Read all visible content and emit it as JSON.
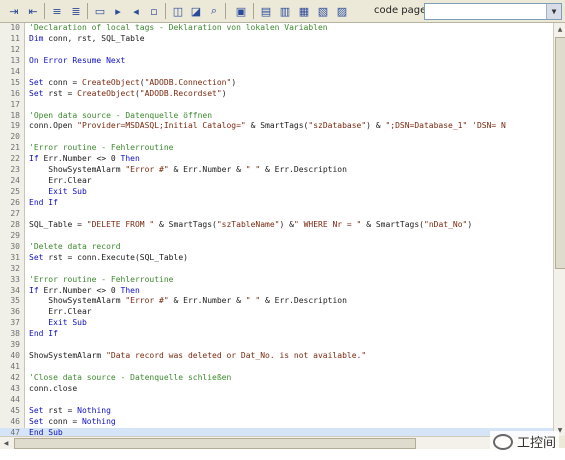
{
  "toolbar": {
    "code_page_label": "code page",
    "code_page_value": "",
    "icons": [
      "indent-icon",
      "outdent-icon",
      "comment-icon",
      "uncomment-icon",
      "toggle-bookmark-icon",
      "bookmark-next-icon",
      "bookmark-prev-icon",
      "clear-bookmarks-icon",
      "tag-icon",
      "insert-tag-icon",
      "find-icon",
      "replace-icon",
      "run-icon",
      "check-syntax-icon",
      "insert-script-icon",
      "tag-list-icon",
      "help-icon"
    ]
  },
  "code": {
    "lines": [
      {
        "n": "10",
        "tokens": [
          {
            "t": "'Declaration of local tags - Deklaration von lokalen Variablen",
            "c": "comment"
          }
        ]
      },
      {
        "n": "11",
        "tokens": [
          {
            "t": "Dim",
            "c": "keyword"
          },
          {
            "t": " conn, rst, SQL_Table",
            "c": "ident"
          }
        ]
      },
      {
        "n": "12",
        "tokens": []
      },
      {
        "n": "13",
        "tokens": [
          {
            "t": "On Error Resume Next",
            "c": "keyword"
          }
        ]
      },
      {
        "n": "14",
        "tokens": []
      },
      {
        "n": "15",
        "tokens": [
          {
            "t": "Set",
            "c": "keyword"
          },
          {
            "t": " conn = ",
            "c": "ident"
          },
          {
            "t": "CreateObject",
            "c": "string"
          },
          {
            "t": "(",
            "c": "ident"
          },
          {
            "t": "\"ADODB.Connection\"",
            "c": "string"
          },
          {
            "t": ")",
            "c": "ident"
          }
        ]
      },
      {
        "n": "16",
        "tokens": [
          {
            "t": "Set",
            "c": "keyword"
          },
          {
            "t": " rst = ",
            "c": "ident"
          },
          {
            "t": "CreateObject",
            "c": "string"
          },
          {
            "t": "(",
            "c": "ident"
          },
          {
            "t": "\"ADODB.Recordset\"",
            "c": "string"
          },
          {
            "t": ")",
            "c": "ident"
          }
        ]
      },
      {
        "n": "17",
        "tokens": []
      },
      {
        "n": "18",
        "tokens": [
          {
            "t": "'Open data source - Datenquelle öffnen",
            "c": "comment"
          }
        ]
      },
      {
        "n": "19",
        "tokens": [
          {
            "t": "conn.Open ",
            "c": "ident"
          },
          {
            "t": "\"Provider=MSDASQL;Initial Catalog=\"",
            "c": "string"
          },
          {
            "t": " & SmartTags(",
            "c": "ident"
          },
          {
            "t": "\"szDatabase\"",
            "c": "string"
          },
          {
            "t": ") & ",
            "c": "ident"
          },
          {
            "t": "\";DSN=Database_1\" 'DSN= N",
            "c": "string"
          }
        ]
      },
      {
        "n": "20",
        "tokens": []
      },
      {
        "n": "21",
        "tokens": [
          {
            "t": "'Error routine - Fehlerroutine",
            "c": "comment"
          }
        ]
      },
      {
        "n": "22",
        "tokens": [
          {
            "t": "If",
            "c": "keyword"
          },
          {
            "t": " Err.Number <> 0 ",
            "c": "ident"
          },
          {
            "t": "Then",
            "c": "keyword"
          }
        ]
      },
      {
        "n": "23",
        "tokens": [
          {
            "t": "    ShowSystemAlarm ",
            "c": "ident"
          },
          {
            "t": "\"Error #\"",
            "c": "string"
          },
          {
            "t": " & Err.Number & ",
            "c": "ident"
          },
          {
            "t": "\" \"",
            "c": "string"
          },
          {
            "t": " & Err.Description",
            "c": "ident"
          }
        ]
      },
      {
        "n": "24",
        "tokens": [
          {
            "t": "    Err.Clear",
            "c": "ident"
          }
        ]
      },
      {
        "n": "25",
        "tokens": [
          {
            "t": "    Exit Sub",
            "c": "keyword"
          }
        ]
      },
      {
        "n": "26",
        "tokens": [
          {
            "t": "End If",
            "c": "keyword"
          }
        ]
      },
      {
        "n": "27",
        "tokens": []
      },
      {
        "n": "28",
        "tokens": [
          {
            "t": "SQL_Table = ",
            "c": "ident"
          },
          {
            "t": "\"DELETE FROM \"",
            "c": "string"
          },
          {
            "t": " & SmartTags(",
            "c": "ident"
          },
          {
            "t": "\"szTableName\"",
            "c": "string"
          },
          {
            "t": ") &",
            "c": "ident"
          },
          {
            "t": "\" WHERE Nr = \"",
            "c": "string"
          },
          {
            "t": " & SmartTags(",
            "c": "ident"
          },
          {
            "t": "\"nDat_No\"",
            "c": "string"
          },
          {
            "t": ")",
            "c": "ident"
          }
        ]
      },
      {
        "n": "29",
        "tokens": []
      },
      {
        "n": "30",
        "tokens": [
          {
            "t": "'Delete data record",
            "c": "comment"
          }
        ]
      },
      {
        "n": "31",
        "tokens": [
          {
            "t": "Set",
            "c": "keyword"
          },
          {
            "t": " rst = conn.Execute(SQL_Table)",
            "c": "ident"
          }
        ]
      },
      {
        "n": "32",
        "tokens": []
      },
      {
        "n": "33",
        "tokens": [
          {
            "t": "'Error routine - Fehlerroutine",
            "c": "comment"
          }
        ]
      },
      {
        "n": "34",
        "tokens": [
          {
            "t": "If",
            "c": "keyword"
          },
          {
            "t": " Err.Number <> 0 ",
            "c": "ident"
          },
          {
            "t": "Then",
            "c": "keyword"
          }
        ]
      },
      {
        "n": "35",
        "tokens": [
          {
            "t": "    ShowSystemAlarm ",
            "c": "ident"
          },
          {
            "t": "\"Error #\"",
            "c": "string"
          },
          {
            "t": " & Err.Number & ",
            "c": "ident"
          },
          {
            "t": "\" \"",
            "c": "string"
          },
          {
            "t": " & Err.Description",
            "c": "ident"
          }
        ]
      },
      {
        "n": "36",
        "tokens": [
          {
            "t": "    Err.Clear",
            "c": "ident"
          }
        ]
      },
      {
        "n": "37",
        "tokens": [
          {
            "t": "    Exit Sub",
            "c": "keyword"
          }
        ]
      },
      {
        "n": "38",
        "tokens": [
          {
            "t": "End If",
            "c": "keyword"
          }
        ]
      },
      {
        "n": "39",
        "tokens": []
      },
      {
        "n": "40",
        "tokens": [
          {
            "t": "ShowSystemAlarm ",
            "c": "ident"
          },
          {
            "t": "\"Data record was deleted or Dat_No. is not available.\"",
            "c": "string"
          }
        ]
      },
      {
        "n": "41",
        "tokens": []
      },
      {
        "n": "42",
        "tokens": [
          {
            "t": "'Close data source - Datenquelle schließen",
            "c": "comment"
          }
        ]
      },
      {
        "n": "43",
        "tokens": [
          {
            "t": "conn.close",
            "c": "ident"
          }
        ]
      },
      {
        "n": "44",
        "tokens": []
      },
      {
        "n": "45",
        "tokens": [
          {
            "t": "Set",
            "c": "keyword"
          },
          {
            "t": " rst = ",
            "c": "ident"
          },
          {
            "t": "Nothing",
            "c": "keyword"
          }
        ]
      },
      {
        "n": "46",
        "tokens": [
          {
            "t": "Set",
            "c": "keyword"
          },
          {
            "t": " conn = ",
            "c": "ident"
          },
          {
            "t": "Nothing",
            "c": "keyword"
          }
        ]
      },
      {
        "n": "47",
        "tokens": [
          {
            "t": "End Sub",
            "c": "keyword"
          }
        ]
      }
    ]
  },
  "watermark": {
    "text": "工控间"
  }
}
